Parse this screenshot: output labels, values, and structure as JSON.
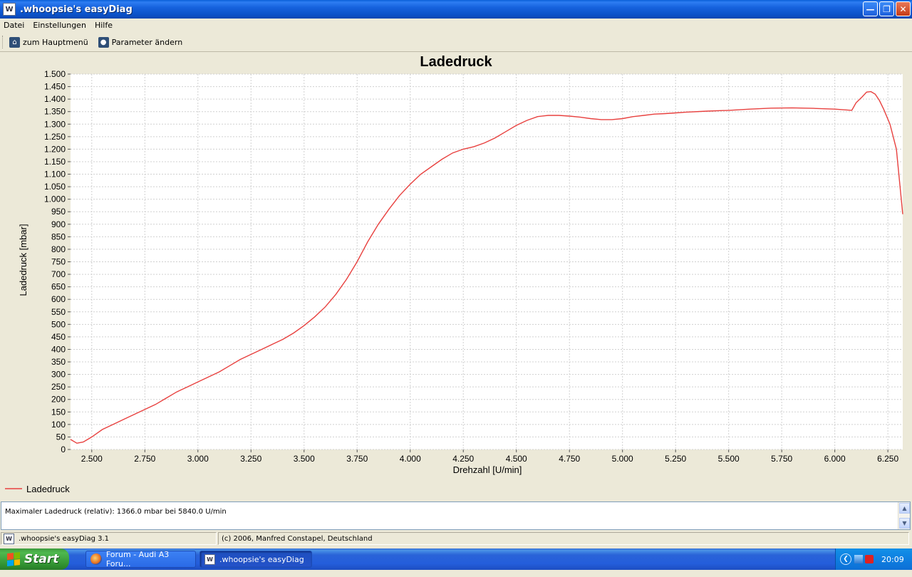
{
  "window": {
    "title": ".whoopsie's easyDiag",
    "icon": "W"
  },
  "menu": {
    "items": [
      "Datei",
      "Einstellungen",
      "Hilfe"
    ]
  },
  "toolbar": {
    "home_label": "zum Hauptmenü",
    "params_label": "Parameter ändern"
  },
  "chart_data": {
    "type": "line",
    "title": "Ladedruck",
    "xlabel": "Drehzahl [U/min]",
    "ylabel": "Ladedruck [mbar]",
    "xlim": [
      2400,
      6320
    ],
    "ylim": [
      0,
      1500
    ],
    "grid": true,
    "legend": "bottom-left",
    "x_ticks": [
      "2.500",
      "2.750",
      "3.000",
      "3.250",
      "3.500",
      "3.750",
      "4.000",
      "4.250",
      "4.500",
      "4.750",
      "5.000",
      "5.250",
      "5.500",
      "5.750",
      "6.000",
      "6.250"
    ],
    "y_ticks": [
      "0",
      "50",
      "100",
      "150",
      "200",
      "250",
      "300",
      "350",
      "400",
      "450",
      "500",
      "550",
      "600",
      "650",
      "700",
      "750",
      "800",
      "850",
      "900",
      "950",
      "1.000",
      "1.050",
      "1.100",
      "1.150",
      "1.200",
      "1.250",
      "1.300",
      "1.350",
      "1.400",
      "1.450",
      "1.500"
    ],
    "series": [
      {
        "name": "Ladedruck",
        "color": "#e8413f",
        "x": [
          2400,
          2430,
          2460,
          2500,
          2550,
          2600,
          2650,
          2700,
          2750,
          2800,
          2850,
          2900,
          2950,
          3000,
          3050,
          3100,
          3150,
          3200,
          3250,
          3300,
          3350,
          3400,
          3450,
          3500,
          3550,
          3600,
          3650,
          3700,
          3750,
          3800,
          3850,
          3900,
          3950,
          4000,
          4050,
          4100,
          4150,
          4200,
          4250,
          4300,
          4350,
          4400,
          4450,
          4500,
          4550,
          4600,
          4650,
          4700,
          4750,
          4800,
          4850,
          4900,
          4950,
          5000,
          5050,
          5100,
          5150,
          5200,
          5250,
          5300,
          5400,
          5500,
          5600,
          5700,
          5800,
          5900,
          6000,
          6080,
          6100,
          6130,
          6150,
          6170,
          6190,
          6210,
          6230,
          6260,
          6290,
          6320
        ],
        "y": [
          40,
          25,
          30,
          50,
          80,
          100,
          120,
          140,
          160,
          180,
          205,
          230,
          250,
          270,
          290,
          310,
          335,
          360,
          380,
          400,
          420,
          440,
          465,
          495,
          530,
          570,
          620,
          680,
          750,
          830,
          900,
          960,
          1015,
          1060,
          1100,
          1130,
          1160,
          1185,
          1200,
          1210,
          1225,
          1245,
          1270,
          1295,
          1315,
          1330,
          1335,
          1335,
          1332,
          1328,
          1322,
          1318,
          1318,
          1322,
          1330,
          1335,
          1340,
          1342,
          1345,
          1348,
          1352,
          1355,
          1360,
          1364,
          1365,
          1363,
          1360,
          1355,
          1385,
          1410,
          1428,
          1430,
          1420,
          1395,
          1360,
          1300,
          1200,
          940
        ]
      }
    ]
  },
  "info": {
    "text": "Maximaler Ladedruck (relativ): 1366.0 mbar bei 5840.0 U/min"
  },
  "status": {
    "app_version": ".whoopsie's easyDiag 3.1",
    "copyright": "(c) 2006, Manfred Constapel, Deutschland"
  },
  "taskbar": {
    "start_label": "Start",
    "items": [
      "Forum - Audi A3 Foru...",
      ".whoopsie's easyDiag"
    ],
    "clock": "20:09"
  }
}
